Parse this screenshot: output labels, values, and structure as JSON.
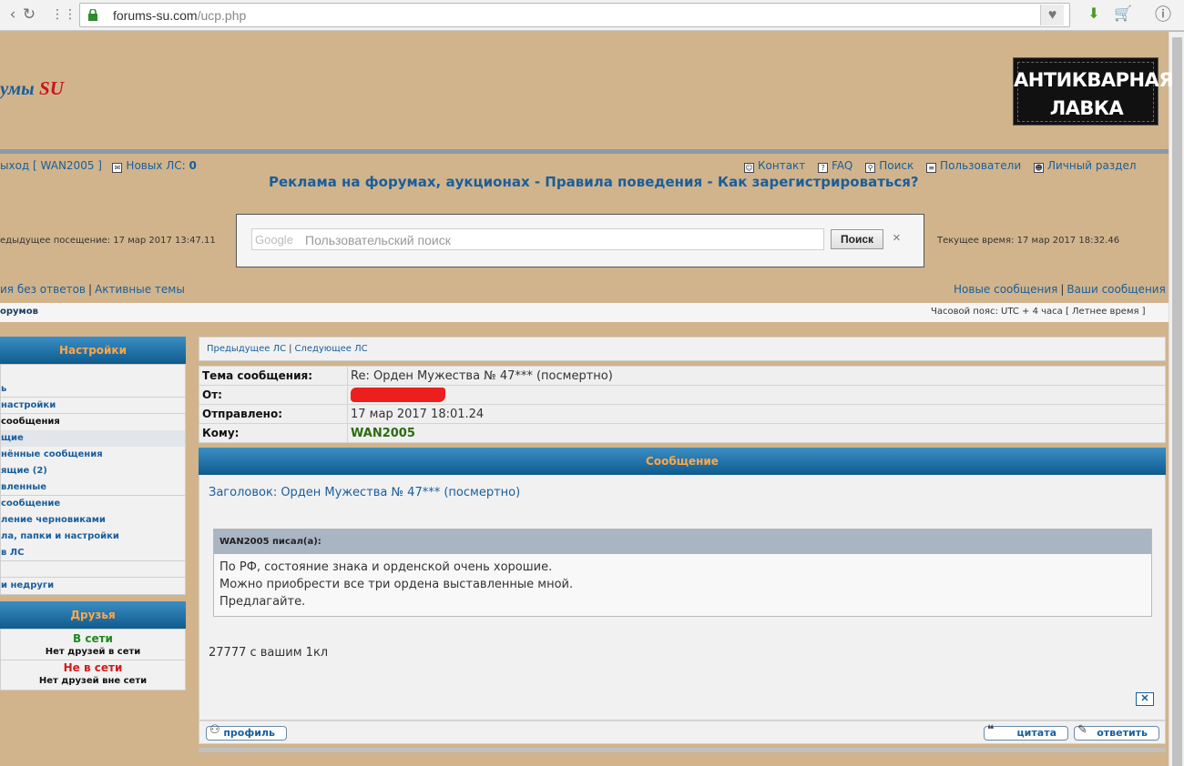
{
  "browser": {
    "url_host": "forums-su.com",
    "url_path": "/ucp.php"
  },
  "site": {
    "title_part": "умы",
    "title_su": "SU"
  },
  "banner": {
    "line1": "АНТИКВАРНАЯ",
    "line2": "ЛАВКА"
  },
  "top_nav": {
    "logout_prefix": "ыход [ ",
    "username": "WAN2005",
    "logout_suffix": " ]",
    "new_pm_label": "Новых ЛС:",
    "new_pm_count": "0",
    "right_links": [
      "Контакт",
      "FAQ",
      "Поиск",
      "Пользователи",
      "Личный раздел"
    ]
  },
  "slogan": "Реклама на форумах, аукционах - Правила поведения - Как зарегистрироваться?",
  "prev_visit": "едыдущее посещение: 17 мар 2017 13:47.11",
  "current_time": "Текущее время: 17 мар 2017 18:32.46",
  "search": {
    "google_label": "Google",
    "placeholder": "Пользовательский поиск",
    "button": "Поиск",
    "close": "×"
  },
  "links_row": {
    "left": [
      "ия без ответов",
      "Активные темы"
    ],
    "right": [
      "Новые сообщения",
      "Ваши сообщения"
    ]
  },
  "breadcrumb": {
    "text": "орумов",
    "timezone": "Часовой пояс: UTC + 4 часа [ Летнее время ]"
  },
  "sidebar": {
    "settings_title": "Настройки",
    "items": [
      {
        "label": "",
        "style": "plain"
      },
      {
        "label": "ь",
        "style": "plain line"
      },
      {
        "label": "настройки",
        "style": "plain line"
      },
      {
        "label": "сообщения",
        "style": "dark"
      },
      {
        "label": "щие",
        "style": "sel"
      },
      {
        "label": "нённые сообщения",
        "style": "plain"
      },
      {
        "label": "ящие (2)",
        "style": "plain"
      },
      {
        "label": "вленные",
        "style": "plain line"
      },
      {
        "label": "сообщение",
        "style": "plain"
      },
      {
        "label": "ление черновиками",
        "style": "plain"
      },
      {
        "label": "ла, папки и настройки",
        "style": "plain"
      },
      {
        "label": "в ЛС",
        "style": "plain line"
      },
      {
        "label": "",
        "style": "plain line"
      },
      {
        "label": "и недруги",
        "style": "plain"
      }
    ],
    "friends_title": "Друзья",
    "online_label": "В сети",
    "online_note": "Нет друзей в сети",
    "offline_label": "Не в сети",
    "offline_note": "Нет друзей вне сети"
  },
  "pm": {
    "prev_label": "Предыдущее ЛС",
    "next_label": "Следующее ЛС",
    "subject_label": "Тема сообщения:",
    "subject": "Re: Орден Мужества № 47*** (посмертно)",
    "from_label": "От:",
    "sent_label": "Отправлено:",
    "sent": "17 мар 2017 18:01.24",
    "to_label": "Кому:",
    "to": "WAN2005",
    "message_header": "Сообщение",
    "title_line": "Заголовок: Орден Мужества № 47*** (посмертно)",
    "quote_author": "WAN2005 писал(а):",
    "quote_lines": [
      "По РФ, состояние знака и орденской очень хорошие.",
      "Можно приобрести все три ордена выставленные мной.",
      "Предлагайте."
    ],
    "body_text": "27777 с вашим 1кл",
    "btn_profile": "профиль",
    "btn_quote": "цитата",
    "btn_reply": "ответить"
  }
}
